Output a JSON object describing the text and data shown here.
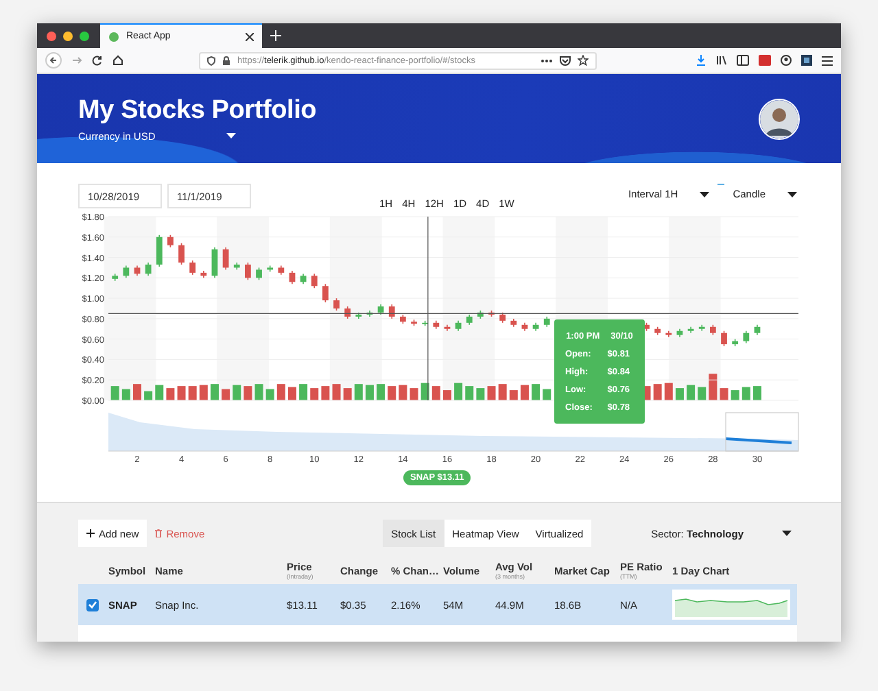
{
  "browser": {
    "tab": {
      "title": "React App"
    },
    "url": "https://**telerik.github.io**/kendo-react-finance-portfolio/#/stocks"
  },
  "header": {
    "title": "My Stocks Portfolio",
    "currency": "Currency in USD"
  },
  "controls": {
    "start_date": "10/28/2019",
    "end_date": "11/1/2019",
    "ranges": [
      {
        "label": "1H",
        "selected": false
      },
      {
        "label": "4H",
        "selected": false
      },
      {
        "label": "12H",
        "selected": false
      },
      {
        "label": "1D",
        "selected": false
      },
      {
        "label": "4D",
        "selected": false
      },
      {
        "label": "1W",
        "selected": false
      }
    ],
    "interval": "Interval 1H",
    "chart_type": "Candle"
  },
  "chart": {
    "chart_data": {
      "type": "candlestick",
      "grid": true,
      "ylim": [
        0,
        1.8
      ],
      "yticks": [
        {
          "value": 0,
          "label": "$0.00"
        },
        {
          "value": 0.2,
          "label": "$0.20"
        },
        {
          "value": 0.4,
          "label": "$0.40"
        },
        {
          "value": 0.6,
          "label": "$0.60"
        },
        {
          "value": 0.8,
          "label": "$0.80"
        },
        {
          "value": 1,
          "label": "$1.00"
        },
        {
          "value": 1.2,
          "label": "$1.20"
        },
        {
          "value": 1.4,
          "label": "$1.40"
        },
        {
          "value": 1.6,
          "label": "$1.60"
        },
        {
          "value": 1.8,
          "label": "$1.80"
        }
      ],
      "xticks": [
        2,
        4,
        6,
        8,
        10,
        12,
        14,
        16,
        18,
        20,
        22,
        24,
        26,
        28,
        30
      ],
      "xlim": [
        0.7,
        31.86
      ],
      "x": [
        1,
        1.5,
        2,
        2.5,
        3,
        3.5,
        4,
        4.5,
        5,
        5.5,
        6,
        6.5,
        7,
        7.5,
        8,
        8.5,
        9,
        9.5,
        10,
        10.5,
        11,
        11.5,
        12,
        12.5,
        13,
        13.5,
        14,
        14.5,
        15,
        15.5,
        16,
        16.5,
        17,
        17.5,
        18,
        18.5,
        19,
        19.5,
        20,
        20.5,
        25,
        25.5,
        26,
        26.5,
        27,
        27.5,
        28,
        28.5,
        29,
        29.5,
        30
      ],
      "ohlc": [
        [
          1.19,
          1.24,
          1.17,
          1.22
        ],
        [
          1.22,
          1.32,
          1.2,
          1.3
        ],
        [
          1.3,
          1.32,
          1.22,
          1.24
        ],
        [
          1.24,
          1.35,
          1.22,
          1.33
        ],
        [
          1.33,
          1.62,
          1.31,
          1.6
        ],
        [
          1.6,
          1.62,
          1.5,
          1.52
        ],
        [
          1.52,
          1.54,
          1.33,
          1.35
        ],
        [
          1.35,
          1.37,
          1.23,
          1.25
        ],
        [
          1.25,
          1.27,
          1.2,
          1.22
        ],
        [
          1.22,
          1.5,
          1.2,
          1.48
        ],
        [
          1.48,
          1.5,
          1.28,
          1.3
        ],
        [
          1.3,
          1.35,
          1.28,
          1.33
        ],
        [
          1.33,
          1.35,
          1.18,
          1.2
        ],
        [
          1.2,
          1.3,
          1.18,
          1.28
        ],
        [
          1.28,
          1.32,
          1.26,
          1.3
        ],
        [
          1.3,
          1.32,
          1.23,
          1.25
        ],
        [
          1.25,
          1.27,
          1.14,
          1.16
        ],
        [
          1.16,
          1.24,
          1.14,
          1.22
        ],
        [
          1.22,
          1.24,
          1.1,
          1.12
        ],
        [
          1.12,
          1.14,
          0.96,
          0.98
        ],
        [
          0.98,
          1.0,
          0.88,
          0.9
        ],
        [
          0.9,
          0.92,
          0.8,
          0.82
        ],
        [
          0.82,
          0.86,
          0.8,
          0.84
        ],
        [
          0.84,
          0.88,
          0.82,
          0.86
        ],
        [
          0.86,
          0.94,
          0.84,
          0.92
        ],
        [
          0.92,
          0.94,
          0.8,
          0.82
        ],
        [
          0.82,
          0.84,
          0.75,
          0.77
        ],
        [
          0.77,
          0.79,
          0.73,
          0.75
        ],
        [
          0.75,
          0.78,
          0.73,
          0.76
        ],
        [
          0.76,
          0.78,
          0.7,
          0.72
        ],
        [
          0.72,
          0.74,
          0.68,
          0.7
        ],
        [
          0.7,
          0.78,
          0.68,
          0.76
        ],
        [
          0.76,
          0.84,
          0.74,
          0.82
        ],
        [
          0.82,
          0.88,
          0.8,
          0.86
        ],
        [
          0.86,
          0.88,
          0.82,
          0.84
        ],
        [
          0.84,
          0.86,
          0.76,
          0.78
        ],
        [
          0.78,
          0.8,
          0.72,
          0.74
        ],
        [
          0.74,
          0.76,
          0.68,
          0.7
        ],
        [
          0.7,
          0.76,
          0.68,
          0.74
        ],
        [
          0.74,
          0.82,
          0.72,
          0.8
        ],
        [
          0.74,
          0.76,
          0.68,
          0.7
        ],
        [
          0.7,
          0.72,
          0.64,
          0.66
        ],
        [
          0.66,
          0.68,
          0.62,
          0.64
        ],
        [
          0.64,
          0.7,
          0.62,
          0.68
        ],
        [
          0.68,
          0.72,
          0.66,
          0.7
        ],
        [
          0.7,
          0.74,
          0.68,
          0.72
        ],
        [
          0.72,
          0.74,
          0.64,
          0.66
        ],
        [
          0.66,
          0.68,
          0.53,
          0.55
        ],
        [
          0.55,
          0.6,
          0.53,
          0.58
        ],
        [
          0.58,
          0.68,
          0.56,
          0.66
        ],
        [
          0.66,
          0.74,
          0.64,
          0.72
        ]
      ],
      "ref_lines": [
        {
          "axis": "y",
          "value": 0.85
        },
        {
          "axis": "x",
          "value": 15.13
        }
      ]
    },
    "tooltip": {
      "time": "1:00 PM",
      "date": "30/10",
      "rows": [
        {
          "label": "Open:",
          "value": "$0.81"
        },
        {
          "label": "High:",
          "value": "$0.84"
        },
        {
          "label": "Low:",
          "value": "$0.76"
        },
        {
          "label": "Close:",
          "value": "$0.78"
        }
      ]
    },
    "badge": "SNAP $13.11"
  },
  "toolbar": {
    "add": "Add new",
    "remove": "Remove",
    "views": [
      {
        "label": "Stock List",
        "selected": true
      },
      {
        "label": "Heatmap View",
        "selected": false
      },
      {
        "label": "Virtualized",
        "selected": false
      }
    ],
    "sector_label": "Sector:",
    "sector": "Technology"
  },
  "table": {
    "columns": [
      {
        "title": "Symbol"
      },
      {
        "title": "Name"
      },
      {
        "title": "Price",
        "sub": "(Intraday)"
      },
      {
        "title": "Change"
      },
      {
        "title": "% Chan…"
      },
      {
        "title": "Volume"
      },
      {
        "title": "Avg Vol",
        "sub": "(3 months)"
      },
      {
        "title": "Market Cap"
      },
      {
        "title": "PE Ratio",
        "sub": "(TTM)"
      },
      {
        "title": "1 Day Chart"
      }
    ],
    "rows": [
      {
        "checked": true,
        "selected": true,
        "cells": [
          "SNAP",
          "Snap Inc.",
          "$13.11",
          "$0.35",
          "2.16%",
          "54M",
          "44.9M",
          "18.6B",
          "N/A"
        ]
      }
    ]
  }
}
